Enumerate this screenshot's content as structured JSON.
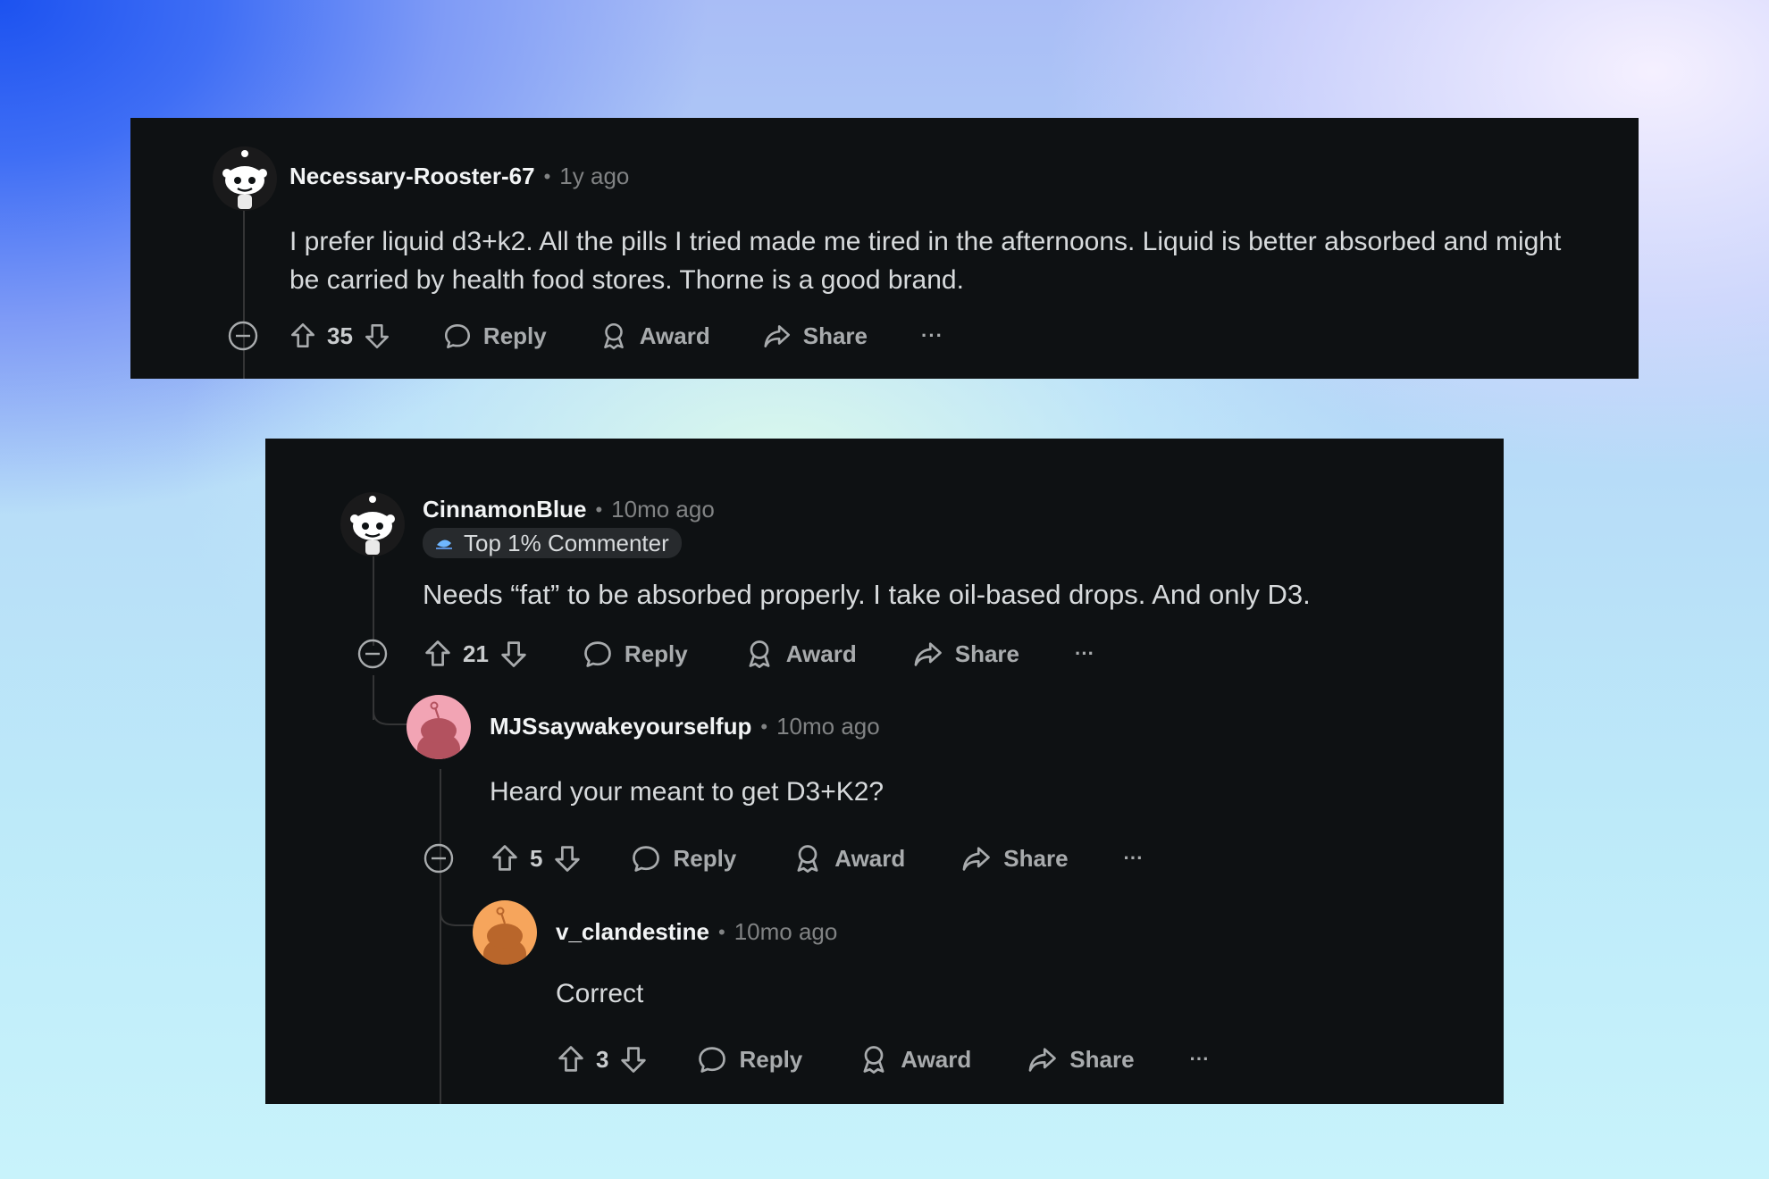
{
  "comments": [
    {
      "username": "Necessary-Rooster-67",
      "time": "1y ago",
      "body": "I prefer liquid d3+k2. All the pills I tried made me tired in the afternoons. Liquid is better absorbed and might be carried by health food stores. Thorne is a good brand.",
      "votes": "35",
      "avatar": "white-snoo-avatar"
    },
    {
      "username": "CinnamonBlue",
      "time": "10mo ago",
      "flair": "Top 1% Commenter",
      "body": "Needs “fat” to be absorbed properly. I take oil-based drops. And only D3.",
      "votes": "21",
      "avatar": "white-snoo-avatar"
    },
    {
      "username": "MJSsaywakeyourselfup",
      "time": "10mo ago",
      "body": "Heard your meant to get D3+K2?",
      "votes": "5",
      "avatar": "pink-snoo-avatar"
    },
    {
      "username": "v_clandestine",
      "time": "10mo ago",
      "body": "Correct",
      "votes": "3",
      "avatar": "orange-snoo-avatar"
    }
  ],
  "actions": {
    "separator": "•",
    "reply": "Reply",
    "award": "Award",
    "share": "Share",
    "more": "···"
  },
  "colors": {
    "panel": "#0e1113",
    "text": "#d7dadc",
    "muted": "#818384",
    "pink_avatar": "#f4a6b6",
    "orange_avatar": "#f5a25a"
  }
}
